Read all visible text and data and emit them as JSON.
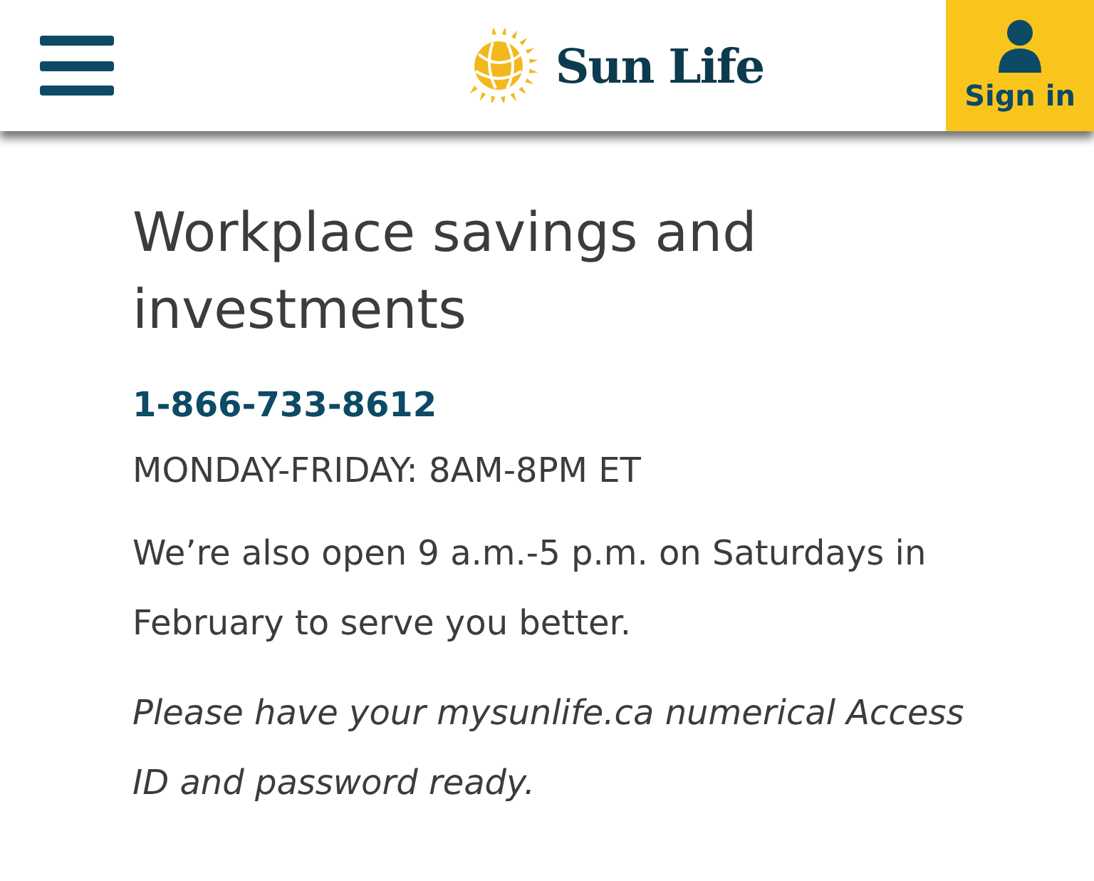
{
  "header": {
    "logo_text": "Sun Life",
    "sign_in": "Sign in"
  },
  "content": {
    "title": "Workplace savings and investments",
    "phone": "1-866-733-8612",
    "hours": "MONDAY-FRIDAY: 8AM-8PM ET",
    "note": "We’re also open 9 a.m.-5 p.m. on Saturdays in February to serve you better.",
    "reminder": "Please have your mysunlife.ca numerical Access ID and password ready."
  }
}
